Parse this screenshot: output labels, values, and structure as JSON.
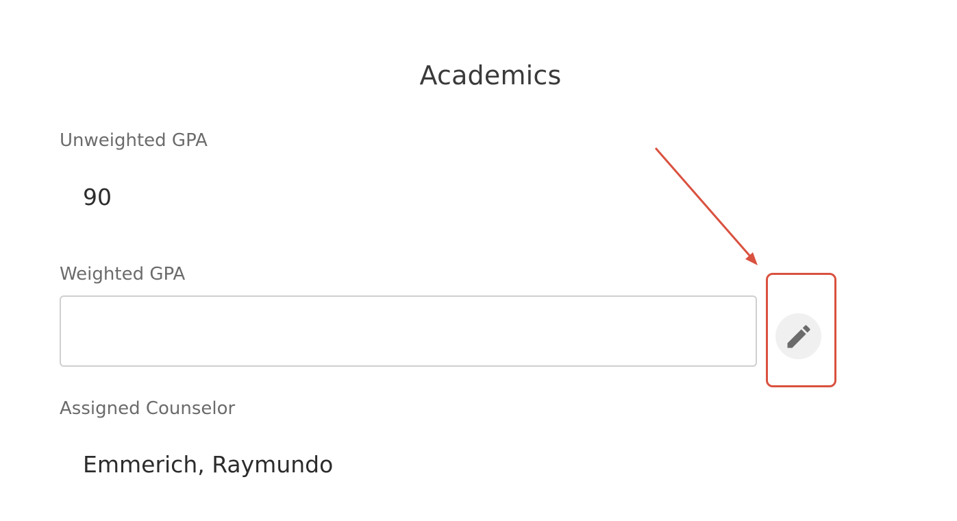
{
  "section": {
    "title": "Academics"
  },
  "fields": {
    "unweighted_gpa": {
      "label": "Unweighted GPA",
      "value": "90"
    },
    "weighted_gpa": {
      "label": "Weighted GPA",
      "value": "",
      "placeholder": ""
    },
    "assigned_counselor": {
      "label": "Assigned Counselor",
      "value": "Emmerich, Raymundo"
    }
  },
  "icons": {
    "edit": "pencil-icon"
  },
  "colors": {
    "annotation": "#d9513f",
    "edit_button_bg": "#f0f0f0",
    "icon": "#6b6b6b"
  }
}
